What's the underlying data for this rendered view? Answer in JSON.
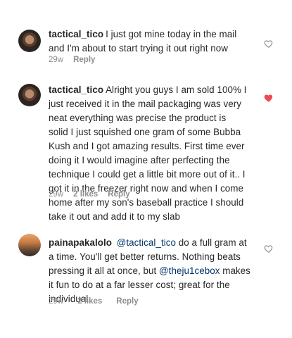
{
  "comments": [
    {
      "username": "tactical_tico",
      "text": "I just got mine today in the mail and I'm about to start trying it out right now",
      "age": "29w",
      "likes": "",
      "reply_label": "Reply",
      "liked": false
    },
    {
      "username": "tactical_tico",
      "text": "Alright you guys I am sold 100% I just received it in the mail packaging was very neat everything was precise the product is solid I just squished one gram of some Bubba Kush and I got amazing results. First time ever doing it I would imagine after perfecting the technique I could get a little bit more out of it.. I got it in the freezer right now and when I come home after my son's baseball practice I should take it out and add it to my slab",
      "age": "29w",
      "likes": "2 likes",
      "reply_label": "Reply",
      "liked": true
    },
    {
      "username": "painapakalolo",
      "mention1": "@tactical_tico",
      "text_part1": "do a full gram at a time. You'll get better returns. Nothing beats pressing it all at once, but",
      "mention2": "@theju1cebox",
      "text_part2": "makes it fun to do at a far lesser cost; great for the individual.",
      "age": "29w",
      "likes": "2 likes",
      "reply_label": "Reply",
      "liked": false
    }
  ],
  "colors": {
    "heart_liked": "#ed4956",
    "heart_outline": "#8e8e8e",
    "mention": "#003569"
  }
}
